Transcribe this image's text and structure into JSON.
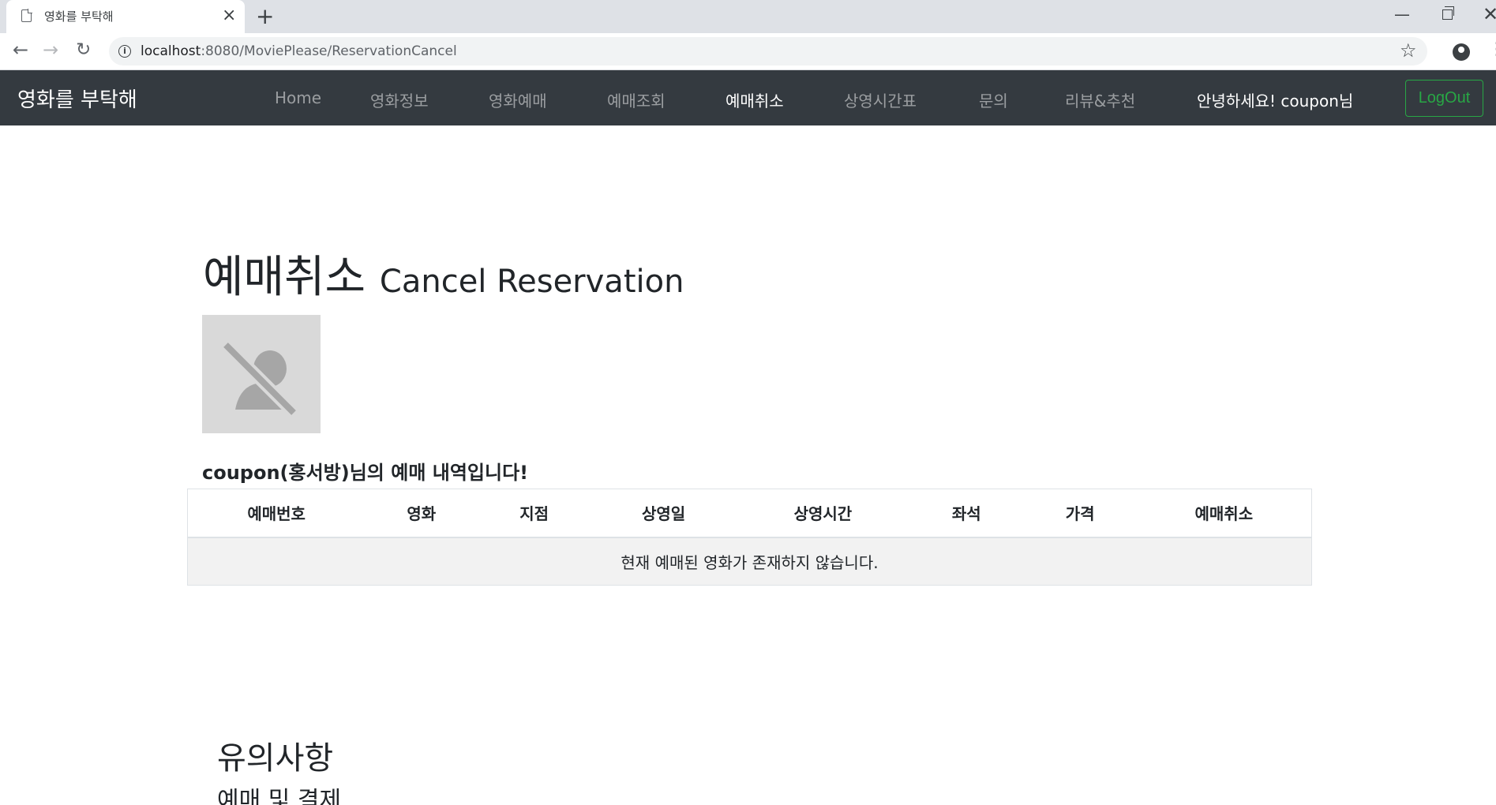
{
  "browser": {
    "tab_title": "영화를 부탁해",
    "url_host": "localhost",
    "url_rest": ":8080/MoviePlease/ReservationCancel"
  },
  "navbar": {
    "brand": "영화를 부탁해",
    "links": [
      {
        "label": "Home",
        "active": false
      },
      {
        "label": "영화정보",
        "active": false
      },
      {
        "label": "영화예매",
        "active": false
      },
      {
        "label": "예매조회",
        "active": false
      },
      {
        "label": "예매취소",
        "active": true
      },
      {
        "label": "상영시간표",
        "active": false
      },
      {
        "label": "문의",
        "active": false
      },
      {
        "label": "리뷰&추천",
        "active": false
      }
    ],
    "greeting": "안녕하세요! coupon님",
    "logout_label": "LogOut"
  },
  "main": {
    "title": "예매취소",
    "title_small": "Cancel Reservation",
    "user_caption": "coupon(홍서방)님의 예매 내역입니다!",
    "table": {
      "headers": [
        "예매번호",
        "영화",
        "지점",
        "상영일",
        "상영시간",
        "좌석",
        "가격",
        "예매취소"
      ],
      "empty_message": "현재 예매된 영화가 존재하지 않습니다."
    }
  },
  "notice": {
    "title": "유의사항",
    "subtitle": "예매 및 결제"
  },
  "colors": {
    "navbar_bg": "#343a40",
    "logout_accent": "#28a745"
  }
}
